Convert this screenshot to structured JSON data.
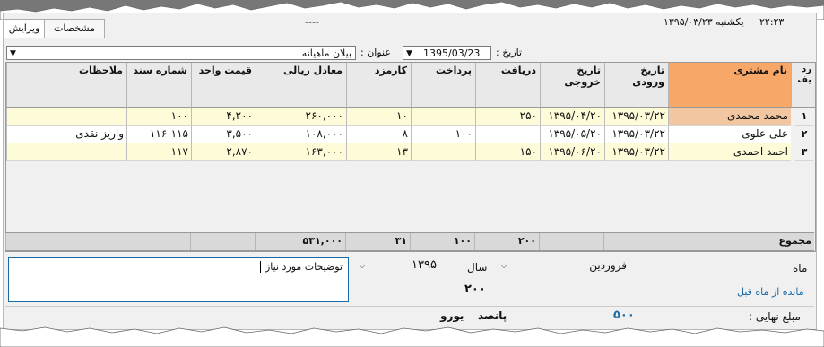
{
  "status": {
    "time": "۲۲:۲۳",
    "date_text": "یکشنبه ۱۳۹۵/۰۳/۲۳",
    "dashes": "----"
  },
  "tabs": [
    {
      "label": "ویرایش"
    },
    {
      "label": "مشخصات"
    }
  ],
  "filters": {
    "date_label": "تاریخ :",
    "date_value": "1395/03/23",
    "title_label": "عنوان :",
    "title_value": "بیلان ماهیانه"
  },
  "grid": {
    "columns": [
      "رد یف",
      "نام مشتری",
      "تاریخ ورودی",
      "تاریخ خروجی",
      "دریافت",
      "پرداخت",
      "کارمزد",
      "معادل ریالی",
      "قیمت واحد",
      "شماره سند",
      "ملاحظات"
    ],
    "rows": [
      {
        "num": "۱",
        "cells": [
          "محمد محمدی",
          "۱۳۹۵/۰۳/۲۲",
          "۱۳۹۵/۰۴/۲۰",
          "۲۵۰",
          "",
          "۱۰",
          "۲۶۰,۰۰۰",
          "۴,۲۰۰",
          "۱۰۰",
          ""
        ]
      },
      {
        "num": "۲",
        "cells": [
          "علی علوی",
          "۱۳۹۵/۰۳/۲۲",
          "۱۳۹۵/۰۵/۲۰",
          "",
          "۱۰۰",
          "۸",
          "۱۰۸,۰۰۰",
          "۳,۵۰۰",
          "۱۱۶-۱۱۵",
          "واریز نقدی"
        ]
      },
      {
        "num": "۳",
        "cells": [
          "احمد احمدی",
          "۱۳۹۵/۰۳/۲۲",
          "۱۳۹۵/۰۶/۲۰",
          "۱۵۰",
          "",
          "۱۳",
          "۱۶۳,۰۰۰",
          "۲,۸۷۰",
          "۱۱۷",
          ""
        ]
      }
    ],
    "sum_label": "مجموع",
    "sums": [
      "",
      "",
      "",
      "۲۰۰",
      "۱۰۰",
      "۳۱",
      "۵۳۱,۰۰۰",
      "",
      "",
      ""
    ]
  },
  "notes": {
    "text": "توضیحات مورد نیاز"
  },
  "month": {
    "label": "ماه",
    "value": "فروردین",
    "year_label": "سال",
    "year_value": "۱۳۹۵",
    "remain_label": "مانده از ماه قبل",
    "remain_value": "۲۰۰"
  },
  "final": {
    "label": "مبلغ نهایی :",
    "number": "۵۰۰",
    "words": "پانصد",
    "currency": "یورو"
  },
  "colors": {
    "selected_header": "#f7a868",
    "selected_cell": "#f3c6a2",
    "row_highlight": "#fefbd8",
    "link_blue": "#1a6aa5"
  }
}
